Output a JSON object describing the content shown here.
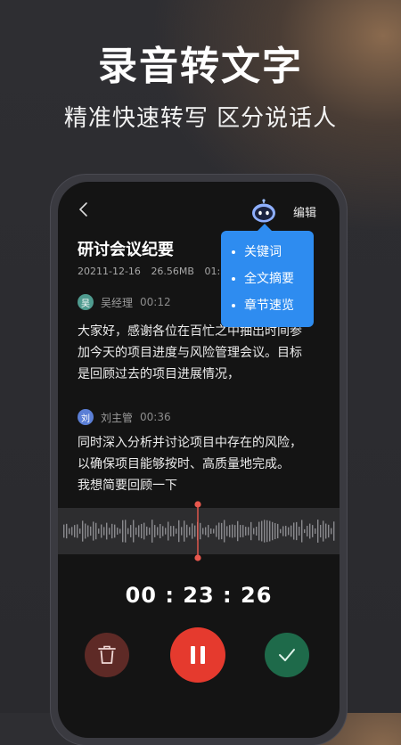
{
  "hero": {
    "title": "录音转文字",
    "subtitle": "精准快速转写 区分说话人"
  },
  "toolbar": {
    "back_icon": "chevron-left-icon",
    "assistant_icon": "robot-icon",
    "edit_label": "编辑"
  },
  "document": {
    "title": "研讨会议纪要",
    "date": "20211-12-16",
    "size": "26.56MB",
    "duration": "01:56"
  },
  "popup_menu": {
    "items": [
      "关键词",
      "全文摘要",
      "章节速览"
    ],
    "color": "#2e8cf0"
  },
  "transcript": [
    {
      "avatar_text": "吴",
      "avatar_color": "#4f9b8f",
      "speaker": "吴经理",
      "time": "00:12",
      "lines": [
        "大家好，感谢各位在百忙之中抽出时间参",
        "加今天的项目进度与风险管理会议。目标",
        "是回顾过去的项目进展情况，"
      ]
    },
    {
      "avatar_text": "刘",
      "avatar_color": "#5b7fd6",
      "speaker": "刘主管",
      "time": "00:36",
      "lines": [
        "同时深入分析并讨论项目中存在的风险，",
        "以确保项目能够按时、高质量地完成。",
        "我想简要回顾一下"
      ]
    }
  ],
  "player": {
    "elapsed": "00 : 23 : 26",
    "playhead_color": "#e8584e"
  },
  "controls": {
    "delete_icon": "trash-icon",
    "pause_icon": "pause-icon",
    "confirm_icon": "check-icon"
  }
}
